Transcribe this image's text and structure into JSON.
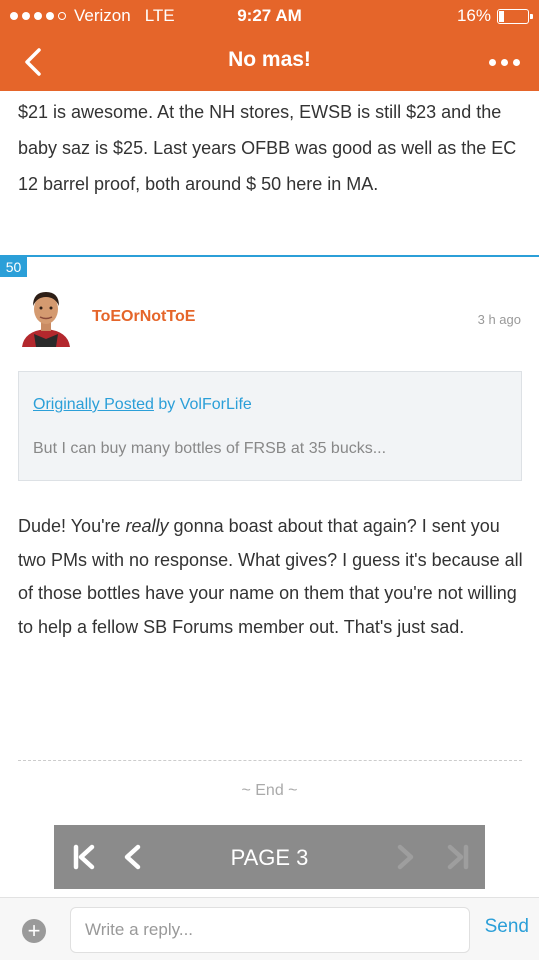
{
  "status_bar": {
    "carrier": "Verizon",
    "network": "LTE",
    "time": "9:27 AM",
    "battery": "16%",
    "battery_level": 0.16,
    "signal_bars": 4,
    "signal_total": 5
  },
  "nav": {
    "title": "No mas!",
    "back_icon": "chevron-left-icon",
    "more_icon": "more-horizontal-icon"
  },
  "previous_post": {
    "text": "$21 is awesome. At the NH stores, EWSB is still  $23 and the baby saz is $25. Last years OFBB was good as well as the EC 12 barrel proof, both around $ 50 here in MA."
  },
  "post": {
    "number": "50",
    "author": "ToEOrNotToE",
    "time": "3 h ago",
    "quote": {
      "link_text": "Originally Posted",
      "by_text": " by VolForLife",
      "text": "But I can buy many bottles of FRSB at 35 bucks..."
    },
    "body_before": "Dude! You're ",
    "body_emphasis": "really",
    "body_after": " gonna boast about that again? I sent you two PMs with no response. What gives? I guess it's because all of those bottles have your name on them that you're not willing to help a fellow SB Forums member out. That's just sad."
  },
  "end_label": "~ End ~",
  "pager": {
    "label": "PAGE 3",
    "first_icon": "first-page-icon",
    "prev_icon": "chevron-left-icon",
    "next_icon": "chevron-right-icon",
    "last_icon": "last-page-icon"
  },
  "reply": {
    "add_label": "+",
    "placeholder": "Write a reply...",
    "send_label": "Send"
  },
  "colors": {
    "brand": "#e5652a",
    "accent": "#2b9fd8",
    "pager_bg": "#8b8b8b"
  }
}
